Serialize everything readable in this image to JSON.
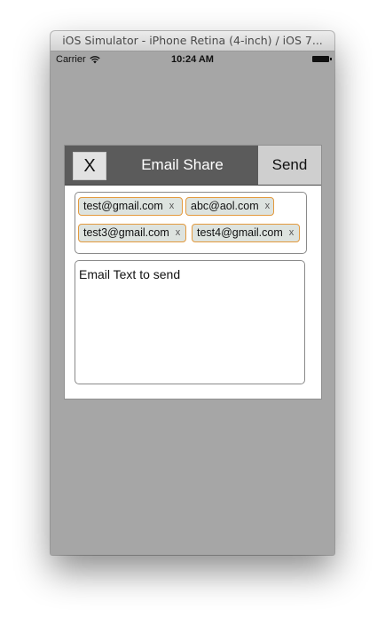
{
  "window": {
    "title": "iOS Simulator - iPhone Retina (4-inch) / iOS 7..."
  },
  "statusbar": {
    "carrier": "Carrier",
    "time": "10:24 AM"
  },
  "email_share": {
    "close_label": "X",
    "title": "Email Share",
    "send_label": "Send",
    "recipients": [
      {
        "email": "test@gmail.com",
        "remove": "x"
      },
      {
        "email": "abc@aol.com",
        "remove": "x"
      },
      {
        "email": "test3@gmail.com",
        "remove": "x"
      },
      {
        "email": "test4@gmail.com",
        "remove": "x"
      }
    ],
    "message_text": "Email Text to send"
  },
  "colors": {
    "screen_background": "#a6a6a6",
    "header_background": "#5b5b5b",
    "send_button_background": "#cfcfcf",
    "token_background": "#dde3df",
    "token_border": "#e39a3e"
  }
}
